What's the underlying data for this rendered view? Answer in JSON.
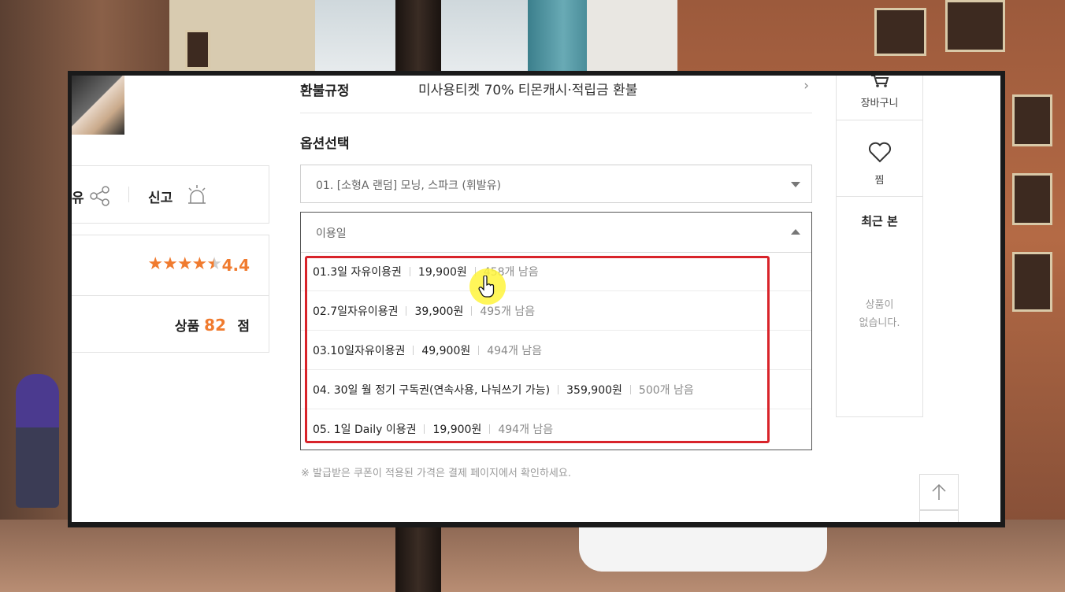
{
  "left": {
    "share_label": "유",
    "report_label": "신고",
    "rating_value": "4.4",
    "rating_stars": 4.4,
    "score_label": "상품",
    "score_value": "82",
    "score_unit": "점"
  },
  "detail": {
    "refund_label": "환불규정",
    "refund_value": "미사용티켓 70% 티몬캐시·적립금 환불",
    "option_title": "옵션선택",
    "select1_value": "01. [소형A 랜덤] 모닝, 스파크 (휘발유)",
    "select2_placeholder": "이용일",
    "options": [
      {
        "name": "01.3일 자유이용권",
        "price": "19,900원",
        "stock": "458개 남음"
      },
      {
        "name": "02.7일자유이용권",
        "price": "39,900원",
        "stock": "495개 남음"
      },
      {
        "name": "03.10일자유이용권",
        "price": "49,900원",
        "stock": "494개 남음"
      },
      {
        "name": "04. 30일 월 정기 구독권(연속사용, 나눠쓰기 가능)",
        "price": "359,900원",
        "stock": "500개 남음"
      },
      {
        "name": "05. 1일 Daily 이용권",
        "price": "19,900원",
        "stock": "494개 남음"
      }
    ],
    "notice": "※ 발급받은 쿠폰이 적용된 가격은 결제 페이지에서 확인하세요."
  },
  "sidebar": {
    "cart_label": "장바구니",
    "wish_label": "찜",
    "recent_title": "최근 본",
    "empty_line1": "상품이",
    "empty_line2": "없습니다."
  },
  "colors": {
    "accent": "#f07b2f",
    "highlight": "#d8232a"
  }
}
